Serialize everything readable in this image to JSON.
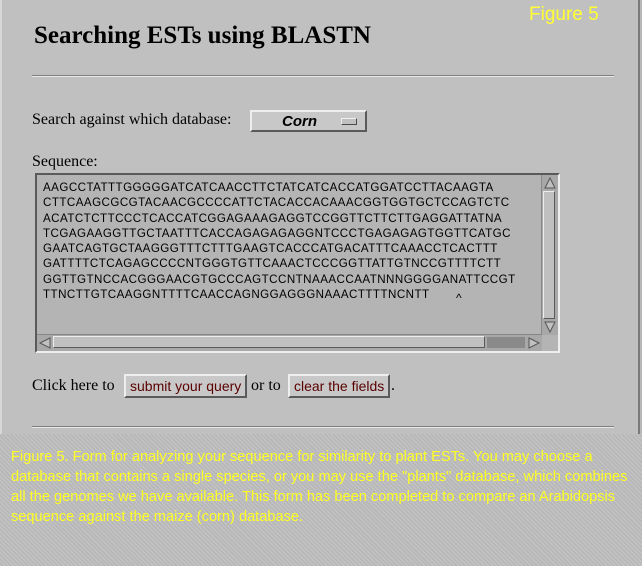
{
  "figure_label": "Figure 5",
  "page_title": "Searching ESTs using BLASTN",
  "database": {
    "label": "Search against which database:",
    "selected": "Corn"
  },
  "sequence": {
    "label": "Sequence:",
    "value": "AAGCCTATTTGGGGGATCATCAACCTTCTATCATCACCATGGATCCTTACAAGTA\nCTTCAAGCGCGTACAACGCCCCATTCTACACCACAAACGGTGGTGCTCCAGTCTC\nACATCTCTTCCCTCACCATCGGAGAAAGAGGTCCGGTTCTTCTTGAGGATTATNA\nTCGAGAAGGTTGCTAATTTCACCAGAGAGAGGNTCCCTGAGAGAGTGGTTCATGC\nGAATCAGTGCTAAGGGTTTCTTTGAAGTCACCCATGACATTTCAAACCTCACTTT\nGATTTTCTCAGAGCCCCNTGGGTGTTCAAACTCCCGGTTATTGTNCCGTTTTCTT\nGGTTGTNCCACGGGAACGTGCCCAGTCCNTNAAACCAATNNNGGGGANATTCCGT\nTTNCTTGTCAAGGNTTTTCAACCAGNGGAGGGNAAACTTTTNCNTT"
  },
  "actions": {
    "prefix": "Click here to",
    "submit_label": "submit your query",
    "middle": "or to",
    "clear_label": "clear the fields",
    "suffix": "."
  },
  "caption": "Figure 5. Form for analyzing your sequence for similarity to plant ESTs. You may choose a database that contains a single species, or you may use the \"plants\" database, which combines all the genomes we have available. This form has been completed to compare an Arabidopsis sequence against the maize (corn) database.",
  "colors": {
    "caption_text": "#ffff22",
    "button_text": "#5a0000",
    "panel": "#c0c0c0"
  },
  "icons": {
    "scroll_up": "up-arrow-icon",
    "scroll_down": "down-arrow-icon",
    "scroll_left": "left-arrow-icon",
    "scroll_right": "right-arrow-icon"
  }
}
